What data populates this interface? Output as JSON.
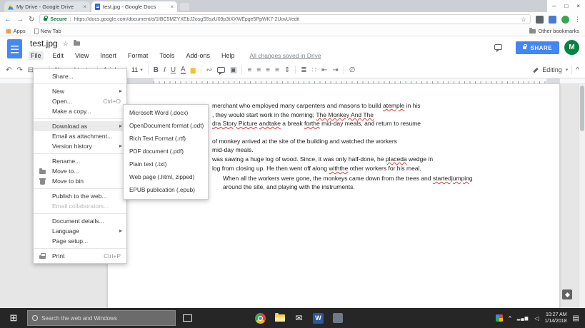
{
  "browser": {
    "tab1": "My Drive - Google Drive",
    "tab2": "test.jpg - Google Docs",
    "secure": "Secure",
    "url": "https://docs.google.com/document/d/1fBC5MZYXEbJ2osgS5szU09p3tXXWEpge5PpWK7-2UovU/edit",
    "apps": "Apps",
    "new_tab": "New Tab",
    "other_bookmarks": "Other bookmarks"
  },
  "docs": {
    "title": "test.jpg",
    "menus": [
      "File",
      "Edit",
      "View",
      "Insert",
      "Format",
      "Tools",
      "Add-ons",
      "Help"
    ],
    "saved": "All changes saved in Drive",
    "share": "SHARE",
    "avatar": "M",
    "style": "Normal text",
    "font": "Arial",
    "font_size": "11",
    "mode": "Editing"
  },
  "file_menu": {
    "items": [
      {
        "label": "Share..."
      },
      {
        "label": "New",
        "submenu": true
      },
      {
        "label": "Open...",
        "shortcut": "Ctrl+O"
      },
      {
        "label": "Make a copy..."
      },
      {
        "label": "Download as",
        "submenu": true,
        "highlighted": true
      },
      {
        "label": "Email as attachment..."
      },
      {
        "label": "Version history",
        "submenu": true
      },
      {
        "label": "Rename..."
      },
      {
        "label": "Move to...",
        "icon": "folder"
      },
      {
        "label": "Move to bin",
        "icon": "trash"
      },
      {
        "label": "Publish to the web..."
      },
      {
        "label": "Email collaborators...",
        "disabled": true
      },
      {
        "label": "Document details..."
      },
      {
        "label": "Language",
        "submenu": true
      },
      {
        "label": "Page setup..."
      },
      {
        "label": "Print",
        "shortcut": "Ctrl+P",
        "icon": "print"
      }
    ]
  },
  "download_menu": {
    "items": [
      {
        "label": "Microsoft Word (.docx)"
      },
      {
        "label": "OpenDocument format (.odt)"
      },
      {
        "label": "Rich Text Format (.rtf)"
      },
      {
        "label": "PDF document (.pdf)"
      },
      {
        "label": "Plain text (.txt)"
      },
      {
        "label": "Web page (.html, zipped)"
      },
      {
        "label": "EPUB publication (.epub)"
      }
    ]
  },
  "document": {
    "lines": [
      {
        "segments": [
          {
            "text": "merchant who employed many carpenters and masons to build "
          },
          {
            "text": "atemple",
            "error": true
          },
          {
            "text": " in his"
          }
        ]
      },
      {
        "segments": [
          {
            "text": ", they would start work in the morning; "
          },
          {
            "text": "The Monkey And The",
            "error": true
          }
        ]
      },
      {
        "segments": [
          {
            "text": "dra Story Picture",
            "error": true
          },
          {
            "text": " "
          },
          {
            "text": "andtake",
            "error": true
          },
          {
            "text": " a break "
          },
          {
            "text": "forthe",
            "error": true
          },
          {
            "text": " mid-day meals, and return to resume"
          }
        ]
      },
      {
        "segments": [
          {
            "text": "of monkey arrived at the site of the building and watched the workers"
          }
        ]
      },
      {
        "segments": [
          {
            "text": "mid-day meals."
          }
        ]
      },
      {
        "segments": [
          {
            "text": "was sawing a huge log of wood. Since, it was only half-done, he "
          },
          {
            "text": "placeda",
            "error": true
          },
          {
            "text": " wedge in"
          }
        ]
      },
      {
        "segments": [
          {
            "text": "log from closing up. He then went off along "
          },
          {
            "text": "withthe",
            "error": true
          },
          {
            "text": " other workers for his meal."
          }
        ]
      },
      {
        "segments": [
          {
            "text": "When all the workers were gone, the monkeys came down from the trees and "
          },
          {
            "text": "startedjumping",
            "error": true
          }
        ]
      },
      {
        "segments": [
          {
            "text": "around the site, and playing with the instruments."
          }
        ]
      }
    ]
  },
  "taskbar": {
    "search_placeholder": "Search the web and Windows",
    "time": "10:27 AM",
    "date": "1/14/2018"
  }
}
